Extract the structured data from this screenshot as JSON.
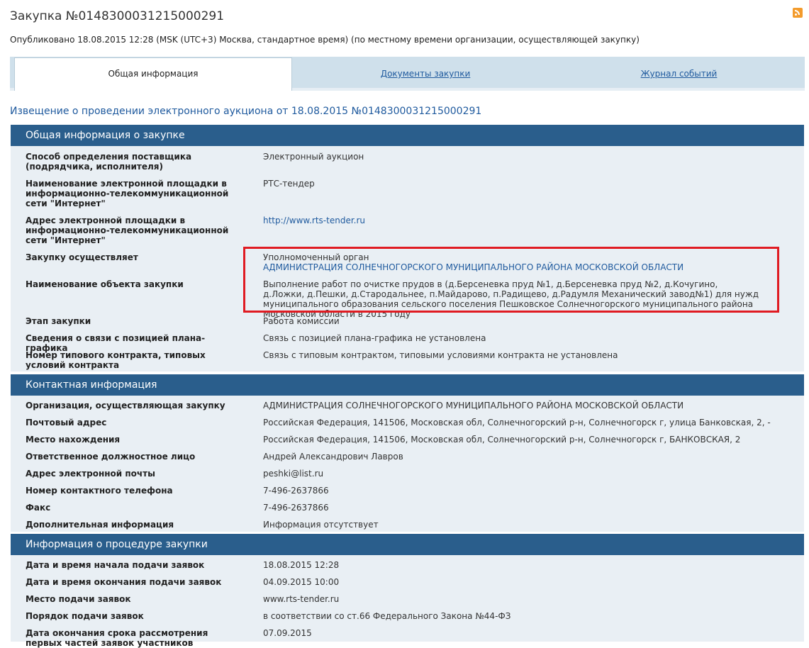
{
  "header": {
    "title": "Закупка №0148300031215000291",
    "published": "Опубликовано 18.08.2015 12:28 (MSK (UTC+3) Москва, стандартное время) (по местному времени организации, осуществляющей закупку)",
    "rss_icon": "rss-icon"
  },
  "tabs": [
    {
      "label": "Общая информация",
      "active": true
    },
    {
      "label": "Документы закупки",
      "active": false
    },
    {
      "label": "Журнал событий",
      "active": false
    }
  ],
  "notice": "Извещение о проведении электронного аукциона от 18.08.2015 №0148300031215000291",
  "general": {
    "heading": "Общая информация о закупке",
    "rows": {
      "method_label": "Способ определения поставщика (подрядчика, исполнителя)",
      "method_value": "Электронный аукцион",
      "platform_label": "Наименование электронной площадки в информационно-телекоммуникационной сети \"Интернет\"",
      "platform_value": "РТС-тендер",
      "address_label": "Адрес электронной площадки в информационно-телекоммуникационной сети \"Интернет\"",
      "address_value": "http://www.rts-tender.ru",
      "buyer_label": "Закупку осуществляет",
      "buyer_value_1": "Уполномоченный орган",
      "buyer_value_2": "АДМИНИСТРАЦИЯ СОЛНЕЧНОГОРСКОГО МУНИЦИПАЛЬНОГО РАЙОНА МОСКОВСКОЙ ОБЛАСТИ",
      "object_label": "Наименование объекта закупки",
      "object_value": "Выполнение работ по очистке прудов в (д.Берсеневка пруд №1, д.Берсеневка пруд №2, д.Кочугино, д.Ложки, д.Пешки, д.Стародальнее, п.Майдарово, п.Радищево, д.Радумля Механический завод№1) для нужд муниципального образования сельского поселения Пешковское Солнечногорского муниципального района Московской области в 2015 году",
      "stage_label": "Этап закупки",
      "stage_value": "Работа комиссии",
      "plan_label": "Сведения о связи с позицией плана-графика",
      "plan_value": "Связь с позицией плана-графика не установлена",
      "contract_label": "Номер типового контракта, типовых условий контракта",
      "contract_value": "Связь с типовым контрактом, типовыми условиями контракта не установлена"
    }
  },
  "contact": {
    "heading": "Контактная информация",
    "rows": [
      {
        "label": "Организация, осуществляющая закупку",
        "value": "АДМИНИСТРАЦИЯ СОЛНЕЧНОГОРСКОГО МУНИЦИПАЛЬНОГО РАЙОНА МОСКОВСКОЙ ОБЛАСТИ"
      },
      {
        "label": "Почтовый адрес",
        "value": "Российская Федерация, 141506, Московская обл, Солнечногорский р-н, Солнечногорск г, улица Банковская, 2, -"
      },
      {
        "label": "Место нахождения",
        "value": "Российская Федерация, 141506, Московская обл, Солнечногорский р-н, Солнечногорск г, БАНКОВСКАЯ, 2"
      },
      {
        "label": "Ответственное должностное лицо",
        "value": "Андрей Александрович Лавров"
      },
      {
        "label": "Адрес электронной почты",
        "value": "peshki@list.ru"
      },
      {
        "label": "Номер контактного телефона",
        "value": "7-496-2637866"
      },
      {
        "label": "Факс",
        "value": "7-496-2637866"
      },
      {
        "label": "Дополнительная информация",
        "value": "Информация отсутствует"
      }
    ]
  },
  "procedure": {
    "heading": "Информация о процедуре закупки",
    "rows": [
      {
        "label": "Дата и время начала подачи заявок",
        "value": "18.08.2015 12:28"
      },
      {
        "label": "Дата и время окончания подачи заявок",
        "value": "04.09.2015 10:00"
      },
      {
        "label": "Место подачи заявок",
        "value": "www.rts-tender.ru"
      },
      {
        "label": "Порядок подачи заявок",
        "value": "в соответствии со ст.66 Федерального Закона №44-ФЗ"
      },
      {
        "label": "Дата окончания срока рассмотрения первых частей заявок участников",
        "value": "07.09.2015"
      }
    ]
  }
}
